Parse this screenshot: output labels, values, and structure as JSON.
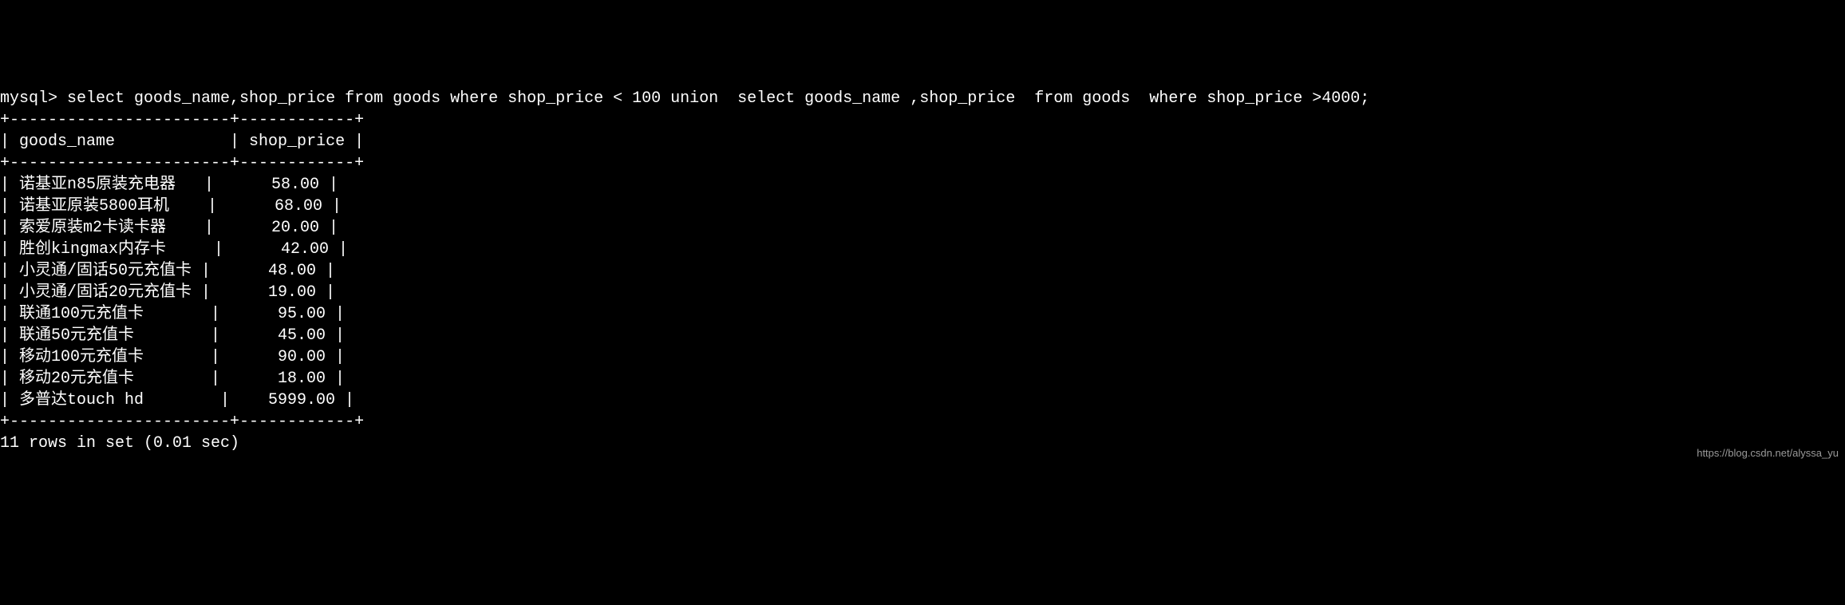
{
  "terminal": {
    "prompt": "mysql> ",
    "query": "select goods_name,shop_price from goods where shop_price < 100 union  select goods_name ,shop_price  from goods  where shop_price >4000;",
    "border_top": "+-----------------------+------------+",
    "header_line": "| goods_name            | shop_price |",
    "border_mid": "+-----------------------+------------+",
    "rows": [
      "| 诺基亚n85原装充电器   |      58.00 |",
      "| 诺基亚原装5800耳机    |      68.00 |",
      "| 索爱原装m2卡读卡器    |      20.00 |",
      "| 胜创kingmax内存卡     |      42.00 |",
      "| 小灵通/固话50元充值卡 |      48.00 |",
      "| 小灵通/固话20元充值卡 |      19.00 |",
      "| 联通100元充值卡       |      95.00 |",
      "| 联通50元充值卡        |      45.00 |",
      "| 移动100元充值卡       |      90.00 |",
      "| 移动20元充值卡        |      18.00 |",
      "| 多普达touch hd        |    5999.00 |"
    ],
    "border_bottom": "+-----------------------+------------+",
    "status": "11 rows in set (0.01 sec)"
  },
  "table_data": {
    "columns": [
      "goods_name",
      "shop_price"
    ],
    "data": [
      {
        "goods_name": "诺基亚n85原装充电器",
        "shop_price": 58.0
      },
      {
        "goods_name": "诺基亚原装5800耳机",
        "shop_price": 68.0
      },
      {
        "goods_name": "索爱原装m2卡读卡器",
        "shop_price": 20.0
      },
      {
        "goods_name": "胜创kingmax内存卡",
        "shop_price": 42.0
      },
      {
        "goods_name": "小灵通/固话50元充值卡",
        "shop_price": 48.0
      },
      {
        "goods_name": "小灵通/固话20元充值卡",
        "shop_price": 19.0
      },
      {
        "goods_name": "联通100元充值卡",
        "shop_price": 95.0
      },
      {
        "goods_name": "联通50元充值卡",
        "shop_price": 45.0
      },
      {
        "goods_name": "移动100元充值卡",
        "shop_price": 90.0
      },
      {
        "goods_name": "移动20元充值卡",
        "shop_price": 18.0
      },
      {
        "goods_name": "多普达touch hd",
        "shop_price": 5999.0
      }
    ]
  },
  "watermark": "https://blog.csdn.net/alyssa_yu"
}
